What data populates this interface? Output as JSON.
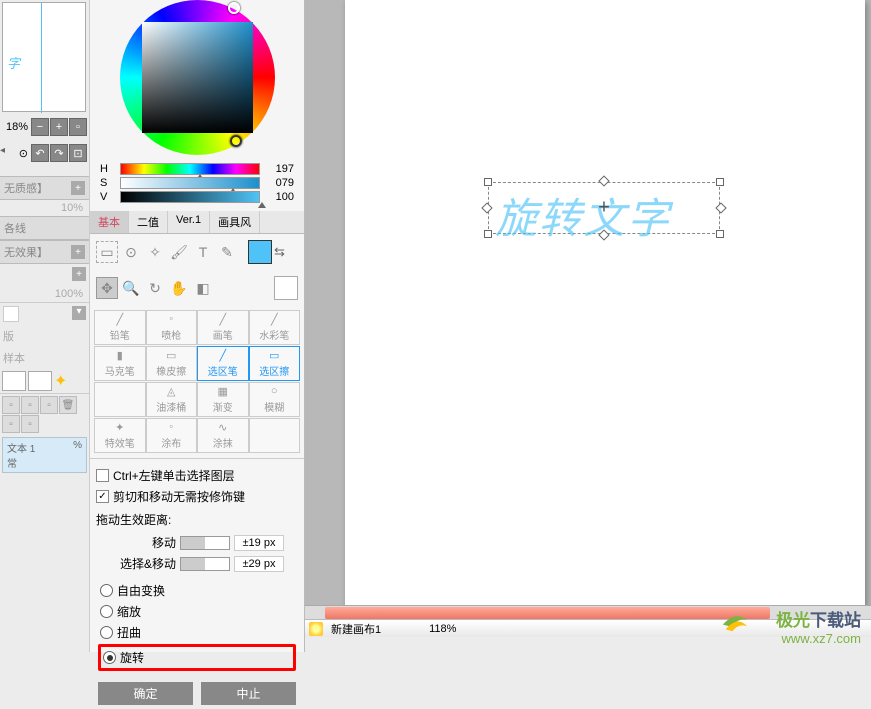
{
  "preview": {
    "text": "字"
  },
  "zoom": {
    "percent": "18%"
  },
  "sections": {
    "quality": {
      "header": "无质感】",
      "value": "10%"
    },
    "line": {
      "header": "各线"
    },
    "effect": {
      "header": "无效果】",
      "value": "100%"
    },
    "copy": {
      "header": "版"
    },
    "sample": {
      "header": "样本"
    }
  },
  "layer_item": {
    "name": "文本 1",
    "mode": "常",
    "opacity": "%"
  },
  "color_wheel": {
    "h": "197",
    "s": "079",
    "v": "100"
  },
  "tabs": {
    "t1": "基本",
    "t2": "二值",
    "t3": "Ver.1",
    "t4": "画具风"
  },
  "brushes": {
    "r1": [
      "铅笔",
      "喷枪",
      "画笔",
      "水彩笔"
    ],
    "r2": [
      "马克笔",
      "橡皮擦",
      "选区笔",
      "选区擦"
    ],
    "r3": [
      "",
      "油漆桶",
      "渐变",
      "模糊"
    ],
    "r4": [
      "特效笔",
      "涂布",
      "涂抹",
      ""
    ]
  },
  "options": {
    "chk1": "Ctrl+左键单击选择图层",
    "chk2": "剪切和移动无需按修饰键",
    "distance_label": "拖动生效距离:",
    "move_label": "移动",
    "move_val": "±19 px",
    "selmove_label": "选择&移动",
    "selmove_val": "±29 px"
  },
  "transform": {
    "free": "自由变换",
    "scale": "缩放",
    "distort": "扭曲",
    "rotate": "旋转"
  },
  "buttons": {
    "ok": "确定",
    "cancel": "中止"
  },
  "canvas": {
    "text": "旋转文字"
  },
  "status": {
    "file": "新建画布1",
    "zoom": "118%"
  },
  "watermark": {
    "brand_a": "极光",
    "brand_b": "下载站",
    "url": "www.xz7.com"
  }
}
